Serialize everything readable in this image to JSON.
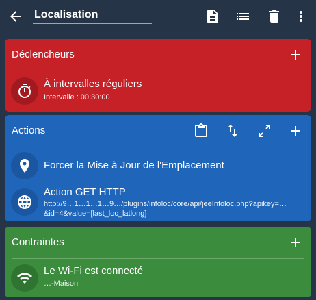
{
  "appbar": {
    "title": "Localisation",
    "icons": [
      "back-arrow-icon",
      "document-icon",
      "list-icon",
      "trash-icon",
      "more-vert-icon"
    ]
  },
  "colors": {
    "background": "#263447",
    "triggers": "#c72128",
    "actions": "#1f66bb",
    "constraints": "#3b8d3d"
  },
  "triggers": {
    "title": "Déclencheurs",
    "items": [
      {
        "icon": "stopwatch-icon",
        "title": "À intervalles réguliers",
        "subtitle": "Intervalle : 00:30:00"
      }
    ]
  },
  "actions": {
    "title": "Actions",
    "header_icons": [
      "clipboard-icon",
      "reorder-icon",
      "expand-icon",
      "add-icon"
    ],
    "items": [
      {
        "icon": "location-pin-icon",
        "title": "Forcer la Mise à Jour de l'Emplacement"
      },
      {
        "icon": "globe-icon",
        "title": "Action GET HTTP",
        "subtitle": "http://9…1…1…1…9…/plugins/infoloc/core/api/jeeInfoloc.php?apikey=…&id=4&value=[last_loc_latlong]"
      }
    ]
  },
  "constraints": {
    "title": "Contraintes",
    "items": [
      {
        "icon": "wifi-icon",
        "title": "Le Wi-Fi est connecté",
        "subtitle": "…-Maison"
      }
    ]
  }
}
